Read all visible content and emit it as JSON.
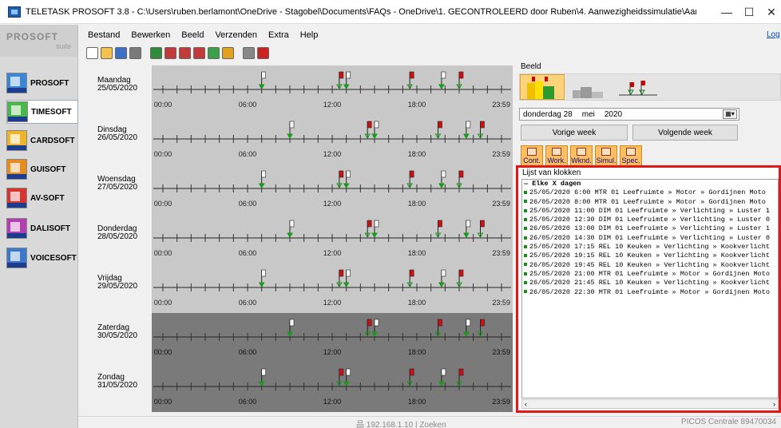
{
  "window": {
    "title": "TELETASK PROSOFT 3.8 - C:\\Users\\ruben.berlamont\\OneDrive - Stagobel\\Documents\\FAQs - OneDrive\\1. GECONTROLEERD door Ruben\\4. Aanwezigheidssimulatie\\Aanwezigheidssimulatie.nbt",
    "minimize": "—",
    "maximize": "☐",
    "close": "✕"
  },
  "logo": {
    "line1": "PROSOFT",
    "line2": "suite"
  },
  "sidebar": {
    "items": [
      {
        "label": "PROSOFT",
        "color": "#3a86d8"
      },
      {
        "label": "TIMESOFT",
        "color": "#49b84a"
      },
      {
        "label": "CARDSOFT",
        "color": "#f0b429"
      },
      {
        "label": "GUISOFT",
        "color": "#e88b1f"
      },
      {
        "label": "AV-SOFT",
        "color": "#d8342f"
      },
      {
        "label": "DALISOFT",
        "color": "#b13fb0"
      },
      {
        "label": "VOICESOFT",
        "color": "#3b78c9"
      }
    ]
  },
  "menu": {
    "items": [
      "Bestand",
      "Bewerken",
      "Beeld",
      "Verzenden",
      "Extra",
      "Help"
    ],
    "log": "Log"
  },
  "toolbar": {
    "buttons": [
      {
        "name": "new-icon",
        "color": "#ffffff"
      },
      {
        "name": "open-icon",
        "color": "#f2c14e"
      },
      {
        "name": "save-icon",
        "color": "#3d6fc4"
      },
      {
        "name": "print-icon",
        "color": "#7a7a7a"
      },
      {
        "name": "find-icon",
        "color": "#2f8a3a"
      },
      {
        "name": "clock-a-icon",
        "color": "#c23a3a"
      },
      {
        "name": "clock-b-icon",
        "color": "#c23a3a"
      },
      {
        "name": "clock-c-icon",
        "color": "#c23a3a"
      },
      {
        "name": "clock-d-icon",
        "color": "#3aa14a"
      },
      {
        "name": "clock-e-icon",
        "color": "#e0a020"
      },
      {
        "name": "search-icon",
        "color": "#888888"
      },
      {
        "name": "delete-icon",
        "color": "#cc2222"
      }
    ]
  },
  "week": {
    "time_labels": [
      "00:00",
      "06:00",
      "12:00",
      "18:00",
      "23:59"
    ],
    "days": [
      {
        "name": "Maandag",
        "date": "25/05/2020",
        "shade": "light",
        "flags": [
          {
            "h": 7.0,
            "c": "g"
          },
          {
            "h": 12.5,
            "c": "r"
          },
          {
            "h": 13.0,
            "c": "g"
          },
          {
            "h": 17.5,
            "c": "r"
          },
          {
            "h": 19.75,
            "c": "g"
          },
          {
            "h": 21.0,
            "c": "r"
          }
        ]
      },
      {
        "name": "Dinsdag",
        "date": "26/05/2020",
        "shade": "light",
        "flags": [
          {
            "h": 9.0,
            "c": "g"
          },
          {
            "h": 14.5,
            "c": "r"
          },
          {
            "h": 15.0,
            "c": "g"
          },
          {
            "h": 19.5,
            "c": "r"
          },
          {
            "h": 21.5,
            "c": "g"
          },
          {
            "h": 22.5,
            "c": "r"
          }
        ]
      },
      {
        "name": "Woensdag",
        "date": "27/05/2020",
        "shade": "light",
        "flags": [
          {
            "h": 7.0,
            "c": "g"
          },
          {
            "h": 12.5,
            "c": "r"
          },
          {
            "h": 13.0,
            "c": "g"
          },
          {
            "h": 17.5,
            "c": "r"
          },
          {
            "h": 19.75,
            "c": "g"
          },
          {
            "h": 21.0,
            "c": "r"
          }
        ]
      },
      {
        "name": "Donderdag",
        "date": "28/05/2020",
        "shade": "light",
        "flags": [
          {
            "h": 9.0,
            "c": "g"
          },
          {
            "h": 14.5,
            "c": "r"
          },
          {
            "h": 15.0,
            "c": "g"
          },
          {
            "h": 19.5,
            "c": "r"
          },
          {
            "h": 21.5,
            "c": "g"
          },
          {
            "h": 22.5,
            "c": "r"
          }
        ]
      },
      {
        "name": "Vrijdag",
        "date": "29/05/2020",
        "shade": "light",
        "flags": [
          {
            "h": 7.0,
            "c": "g"
          },
          {
            "h": 12.5,
            "c": "r"
          },
          {
            "h": 13.0,
            "c": "g"
          },
          {
            "h": 17.5,
            "c": "r"
          },
          {
            "h": 19.75,
            "c": "g"
          },
          {
            "h": 21.0,
            "c": "r"
          }
        ]
      },
      {
        "name": "Zaterdag",
        "date": "30/05/2020",
        "shade": "dark",
        "flags": [
          {
            "h": 9.0,
            "c": "g"
          },
          {
            "h": 14.5,
            "c": "r"
          },
          {
            "h": 15.0,
            "c": "g"
          },
          {
            "h": 19.5,
            "c": "r"
          },
          {
            "h": 21.5,
            "c": "g"
          },
          {
            "h": 22.5,
            "c": "r"
          }
        ]
      },
      {
        "name": "Zondag",
        "date": "31/05/2020",
        "shade": "dark",
        "flags": [
          {
            "h": 7.0,
            "c": "g"
          },
          {
            "h": 12.5,
            "c": "r"
          },
          {
            "h": 13.0,
            "c": "g"
          },
          {
            "h": 17.5,
            "c": "r"
          },
          {
            "h": 19.75,
            "c": "g"
          },
          {
            "h": 21.0,
            "c": "r"
          }
        ]
      }
    ]
  },
  "panel": {
    "group_title": "Beeld",
    "date": {
      "day": "donderdag 28",
      "month": "mei",
      "year": "2020"
    },
    "prev_week": "Vorige week",
    "next_week": "Volgende week",
    "sim_buttons": [
      "Cont.",
      "Work.",
      "Wknd.",
      "Simul.",
      "Spec."
    ],
    "clock_list_title": "Lijst van klokken",
    "clock_list_header": "— Elke X dagen",
    "clocks": [
      "25/05/2020  6:00 MTR  01  Leefruimte » Motor » Gordijnen Moto",
      "26/05/2020  8:00 MTR  01  Leefruimte » Motor » Gordijnen Moto",
      "25/05/2020 11:00 DIM  01  Leefruimte » Verlichting » Luster 1",
      "25/05/2020 12:30 DIM  01  Leefruimte » Verlichting » Luster 0",
      "26/05/2020 13:00 DIM  01  Leefruimte » Verlichting » Luster 1",
      "26/05/2020 14:30 DIM  01  Leefruimte » Verlichting » Luster 0",
      "25/05/2020 17:15 REL  10  Keuken » Verlichting » Kookverlicht",
      "25/05/2020 19:15 REL  10  Keuken » Verlichting » Kookverlicht",
      "26/05/2020 19:45 REL  10  Keuken » Verlichting » Kookverlicht",
      "25/05/2020 21:00 MTR  01  Leefruimte » Motor » Gordijnen Moto",
      "26/05/2020 21:45 REL  10  Keuken » Verlichting » Kookverlicht",
      "26/05/2020 22:30 MTR  01  Leefruimte » Motor » Gordijnen Moto"
    ]
  },
  "status": {
    "ip": "192.168.1.10 | Zoeken",
    "central": "PICOS Centrale 89470034"
  }
}
